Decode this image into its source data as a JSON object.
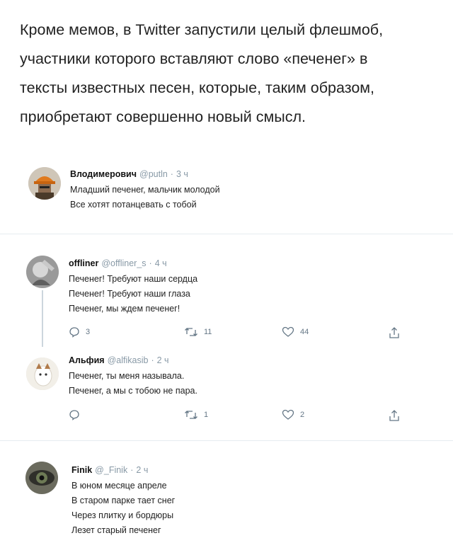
{
  "intro": {
    "lines": [
      "Кроме мемов, в Twitter запустили целый флешмоб,",
      "участники которого вставляют слово «печенег» в",
      "тексты известных песен, которые, таким образом,",
      "приобретают совершенно новый смысл."
    ]
  },
  "tweets": [
    {
      "name": "Влодимерович",
      "handle": "@putln",
      "time": "3 ч",
      "lines": [
        "Младший печенег, мальчик молодой",
        "Все хотят потанцевать с тобой"
      ]
    },
    {
      "name": "offliner",
      "handle": "@offliner_s",
      "time": "4 ч",
      "lines": [
        "Печенег! Требуют наши сердца",
        "Печенег! Требуют наши глаза",
        "Печенег, мы ждем печенег!"
      ],
      "replies": "3",
      "retweets": "11",
      "likes": "44"
    },
    {
      "name": "Альфия",
      "handle": "@alfikasib",
      "time": "2 ч",
      "lines": [
        "Печенег, ты меня называла.",
        "Печенег, а мы с тобою не пара."
      ],
      "replies": "",
      "retweets": "1",
      "likes": "2"
    },
    {
      "name": "Finik",
      "handle": "@_Finik",
      "time": "2 ч",
      "lines": [
        "В юном месяце апреле",
        "В старом парке тает снег",
        "Через плитку и бордюры",
        "Лезет старый печенег"
      ]
    }
  ],
  "separator": "·"
}
